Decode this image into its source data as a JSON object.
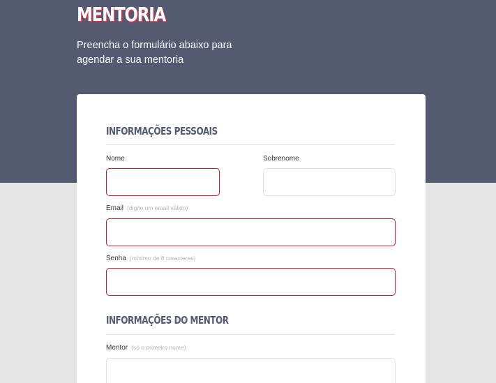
{
  "header": {
    "title": "MENTORIA",
    "subtitle": "Preencha o formulário abaixo para agendar a sua mentoria"
  },
  "form": {
    "personal_section_title": "INFORMAÇÕES PESSOAIS",
    "first_name_label": "Nome",
    "last_name_label": "Sobrenome",
    "email_label": "Email",
    "email_hint": "(digite um email válido)",
    "password_label": "Senha",
    "password_hint": "(mínimo de 8 caracteres)",
    "mentor_section_title": "INFORMAÇÕES DO MENTOR",
    "mentor_label": "Mentor",
    "mentor_hint": "(só o primeiro nome)"
  },
  "colors": {
    "hero_background": "#535a71",
    "page_background": "#e5e5e5",
    "error_border": "#c81c23",
    "section_title": "#535a71"
  }
}
